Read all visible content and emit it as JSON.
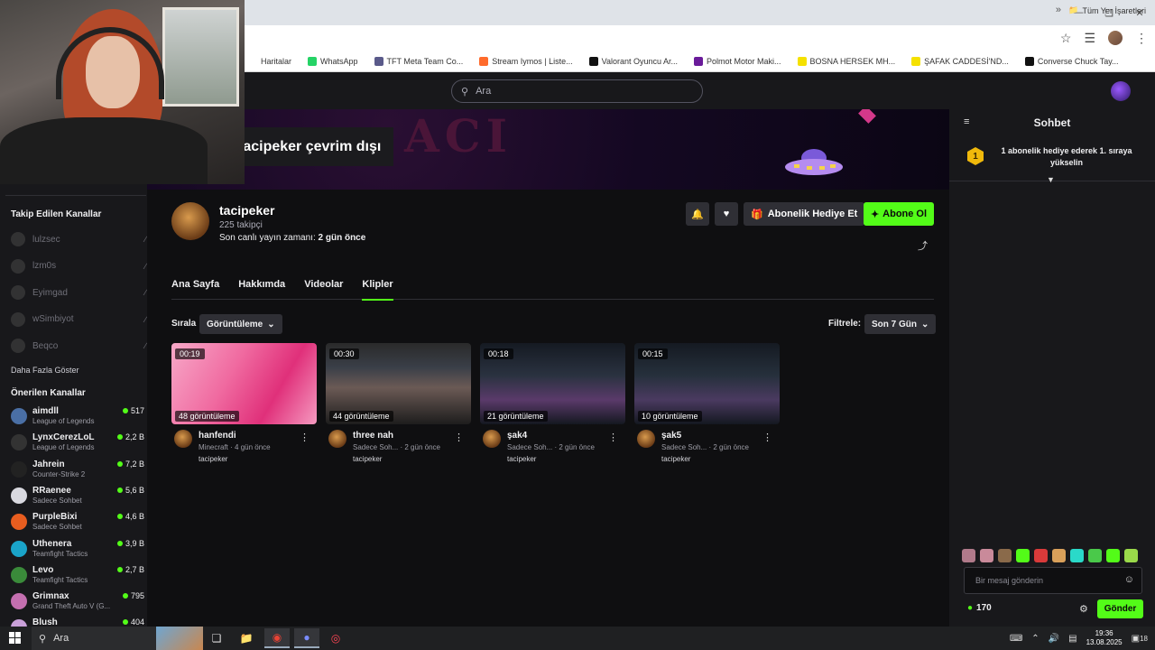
{
  "browser": {
    "bookmarks": [
      {
        "label": "Haritalar",
        "color": "#ffffff"
      },
      {
        "label": "WhatsApp",
        "color": "#25d366"
      },
      {
        "label": "TFT Meta Team Co...",
        "color": "#5a5a8a"
      },
      {
        "label": "Stream Iymos | Liste...",
        "color": "#ff6b2c"
      },
      {
        "label": "Valorant Oyuncu Ar...",
        "color": "#111111"
      },
      {
        "label": "Polmot Motor Maki...",
        "color": "#6a1b9a"
      },
      {
        "label": "BOSNA HERSEK MH...",
        "color": "#f5e100"
      },
      {
        "label": "ŞAFAK CADDESİ'ND...",
        "color": "#f5e100"
      },
      {
        "label": "Converse Chuck Tay...",
        "color": "#111111"
      }
    ],
    "bookmarks_folder": "Tüm Yer İşaretleri"
  },
  "header": {
    "search_placeholder": "Ara"
  },
  "banner": {
    "offline_text": "tacipeker çevrim dışı",
    "art_text": "ACI"
  },
  "channel": {
    "name": "tacipeker",
    "followers": "225 takipçi",
    "last_stream_prefix": "Son canlı yayın zamanı:",
    "last_stream_value": "2 gün önce",
    "gift_sub_label": "Abonelik Hediye Et",
    "subscribe_label": "Abone Ol"
  },
  "tabs": [
    {
      "label": "Ana Sayfa",
      "active": false
    },
    {
      "label": "Hakkımda",
      "active": false
    },
    {
      "label": "Videolar",
      "active": false
    },
    {
      "label": "Klipler",
      "active": true
    }
  ],
  "controls": {
    "sort_label": "Sırala",
    "sort_value": "Görüntüleme",
    "filter_label": "Filtrele:",
    "filter_value": "Son 7 Gün"
  },
  "clips": [
    {
      "duration": "00:19",
      "views": "48 görüntüleme",
      "title": "hanfendi",
      "category": "Minecraft",
      "age": "4 gün önce",
      "owner": "tacipeker"
    },
    {
      "duration": "00:30",
      "views": "44 görüntüleme",
      "title": "three nah",
      "category": "Sadece Soh...",
      "age": "2 gün önce",
      "owner": "tacipeker"
    },
    {
      "duration": "00:18",
      "views": "21 görüntüleme",
      "title": "şak4",
      "category": "Sadece Soh...",
      "age": "2 gün önce",
      "owner": "tacipeker"
    },
    {
      "duration": "00:15",
      "views": "10 görüntüleme",
      "title": "şak5",
      "category": "Sadece Soh...",
      "age": "2 gün önce",
      "owner": "tacipeker"
    }
  ],
  "sidebar": {
    "following_title": "Takip Edilen Kanallar",
    "following": [
      {
        "name": "lulzsec"
      },
      {
        "name": "lzm0s"
      },
      {
        "name": "Eyimgad"
      },
      {
        "name": "wSimbiyot"
      },
      {
        "name": "Beqco"
      }
    ],
    "show_more": "Daha Fazla Göster",
    "recommended_title": "Önerilen Kanallar",
    "recommended": [
      {
        "name": "aimdll",
        "category": "League of Legends",
        "viewers": "517",
        "color": "#4a6fa5"
      },
      {
        "name": "LynxCerezLoL",
        "category": "League of Legends",
        "viewers": "2,2 B",
        "color": "#333333"
      },
      {
        "name": "Jahrein",
        "category": "Counter-Strike 2",
        "viewers": "7,2 B",
        "color": "#222222"
      },
      {
        "name": "RRaenee",
        "category": "Sadece Sohbet",
        "viewers": "5,6 B",
        "color": "#d9d9e0"
      },
      {
        "name": "PurpleBixi",
        "category": "Sadece Sohbet",
        "viewers": "4,6 B",
        "color": "#e85d1f"
      },
      {
        "name": "Uthenera",
        "category": "Teamfight Tactics",
        "viewers": "3,9 B",
        "color": "#1aa4c9"
      },
      {
        "name": "Levo",
        "category": "Teamfight Tactics",
        "viewers": "2,7 B",
        "color": "#3a8a3a"
      },
      {
        "name": "Grimnax",
        "category": "Grand Theft Auto V (G...",
        "viewers": "795",
        "color": "#c46fb0"
      },
      {
        "name": "Blush",
        "category": "",
        "viewers": "404",
        "color": "#c9a0d9"
      }
    ]
  },
  "chat": {
    "title": "Sohbet",
    "gift_rank_number": "1",
    "gift_rank_text": "1 abonelik hediye ederek 1. sıraya yükselin",
    "input_placeholder": "Bir mesaj gönderin",
    "points": "170",
    "send_label": "Gönder"
  },
  "taskbar": {
    "search_placeholder": "Ara",
    "time": "19:36",
    "date": "13.08.2025",
    "notification_count": "18"
  }
}
